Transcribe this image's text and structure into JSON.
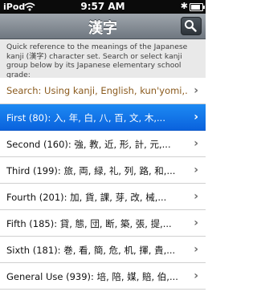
{
  "status_bar": {
    "carrier": "iPod",
    "time": "9:57 AM",
    "battery_level": 0.85
  },
  "navbar": {
    "title": "漢字",
    "search_icon": "search-icon"
  },
  "intro": {
    "text": "Quick reference to the meanings of the Japanese kanji (漢字) character set. Search or select kanji group below by its Japanese elementary school grade:"
  },
  "list": {
    "items": [
      {
        "label": "Search: Using kanji, English, kun'yomi,..."
      },
      {
        "label": "First (80): 入, 年, 白, 八, 百, 文, 木,..."
      },
      {
        "label": "Second (160): 強, 教, 近, 形, 計, 元,..."
      },
      {
        "label": "Third (199): 旅, 両, 緑, 礼, 列, 路, 和,..."
      },
      {
        "label": "Fourth (201): 加, 貨, 課, 芽, 改, 械,..."
      },
      {
        "label": "Fifth (185): 貸, 態, 団, 断, 築, 張, 提,..."
      },
      {
        "label": "Sixth (181): 巻, 看, 簡, 危, 机, 揮, 貴,..."
      },
      {
        "label": "General Use (939): 培, 陪, 媒, 賠, 伯,..."
      }
    ],
    "selected_index": 1,
    "chevron": "chevron-right-icon"
  },
  "colors": {
    "selected_row": "#1377ea",
    "search_text": "#8a5a1d",
    "navbar": "#8a9299"
  }
}
